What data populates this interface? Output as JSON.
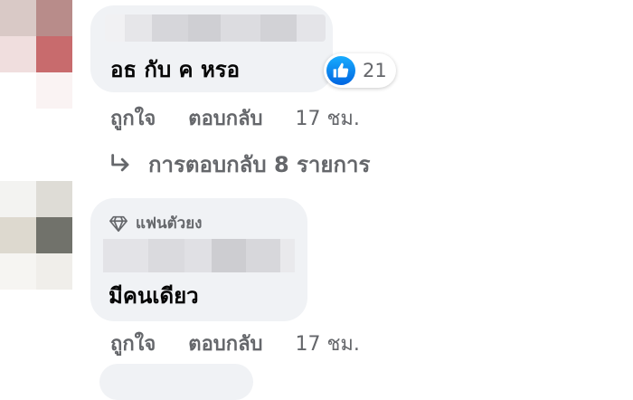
{
  "comments": [
    {
      "text": "อธ กับ ค หรอ",
      "reaction_count": "21",
      "like_label": "ถูกใจ",
      "reply_label": "ตอบกลับ",
      "time": "17 ชม.",
      "view_replies": "การตอบกลับ 8 รายการ"
    },
    {
      "badge": "แฟนตัวยง",
      "text": "มีคนเดียว",
      "like_label": "ถูกใจ",
      "reply_label": "ตอบกลับ",
      "time": "17 ชม."
    }
  ],
  "colors": {
    "bubble_bg": "#f0f2f5",
    "secondary_text": "#65676b",
    "like_blue": "#0866ff"
  }
}
